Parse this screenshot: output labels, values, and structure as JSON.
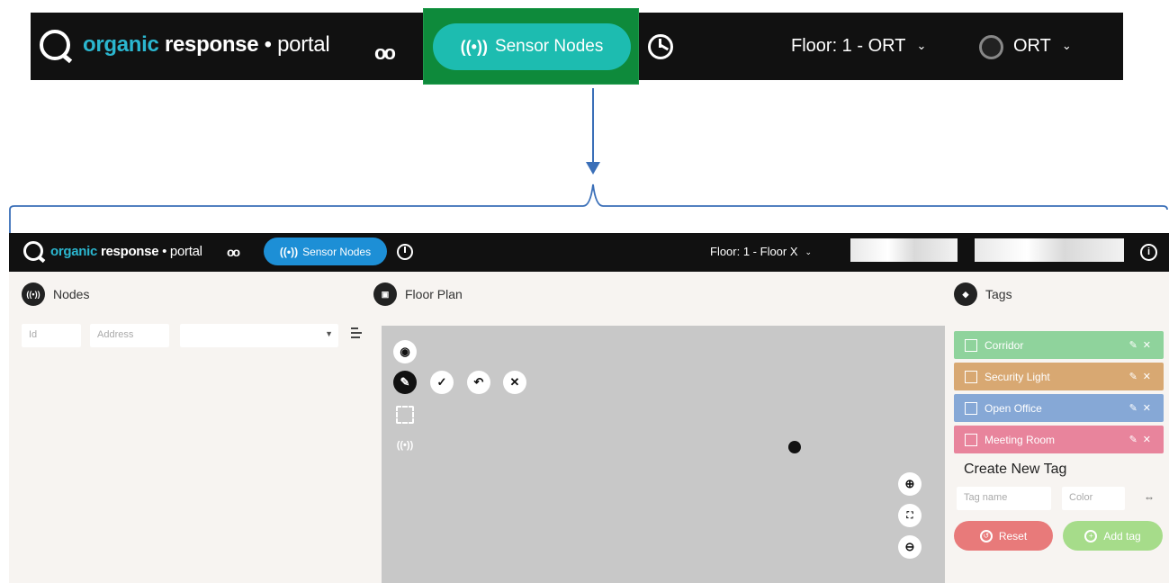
{
  "top_nav": {
    "brand": {
      "part1": "organic",
      "part2": "response",
      "part3": " • portal"
    },
    "glasses_icon": "glasses-icon",
    "sensor_nodes_label": "Sensor Nodes",
    "sensor_icon_glyph": "((•))",
    "clock_icon": "clock-icon",
    "floor_label": "Floor: 1 - ORT",
    "user_label": "ORT",
    "chevron": "⌄",
    "highlight_color": "#0e8a3b",
    "button_color": "#1dbcb0"
  },
  "nav": {
    "brand": {
      "part1": "organic",
      "part2": "response",
      "part3": " • portal"
    },
    "sensor_nodes_label": "Sensor Nodes",
    "sensor_icon_glyph": "((•))",
    "floor_label": "Floor: 1 - Floor X",
    "chevron": "⌄",
    "info_glyph": "i",
    "button_color": "#1d8fd6"
  },
  "nodes": {
    "title": "Nodes",
    "icon_glyph": "((•))",
    "id_placeholder": "Id",
    "address_placeholder": "Address",
    "select_caret": "▼"
  },
  "floor_plan": {
    "title": "Floor Plan",
    "icon_glyph": "▣",
    "tools": {
      "eye": "◉",
      "edit": "✎",
      "check": "✓",
      "undo": "↶",
      "cancel": "✕",
      "signal": "((•))",
      "zoom_in": "⊕",
      "fit": "⛶",
      "zoom_out": "⊖"
    }
  },
  "tags": {
    "title": "Tags",
    "icon_glyph": "◆",
    "items": [
      {
        "label": "Corridor",
        "color": "#8fd39c"
      },
      {
        "label": "Security Light",
        "color": "#d8a872"
      },
      {
        "label": "Open Office",
        "color": "#86a8d6"
      },
      {
        "label": "Meeting Room",
        "color": "#e8849c"
      }
    ],
    "item_actions": "✎✕",
    "create_title": "Create New Tag",
    "tagname_placeholder": "Tag name",
    "color_placeholder": "Color",
    "swap_glyph": "⇔",
    "reset_label": "Reset",
    "add_label": "Add tag",
    "reset_glyph": "↺",
    "add_glyph": "+"
  }
}
